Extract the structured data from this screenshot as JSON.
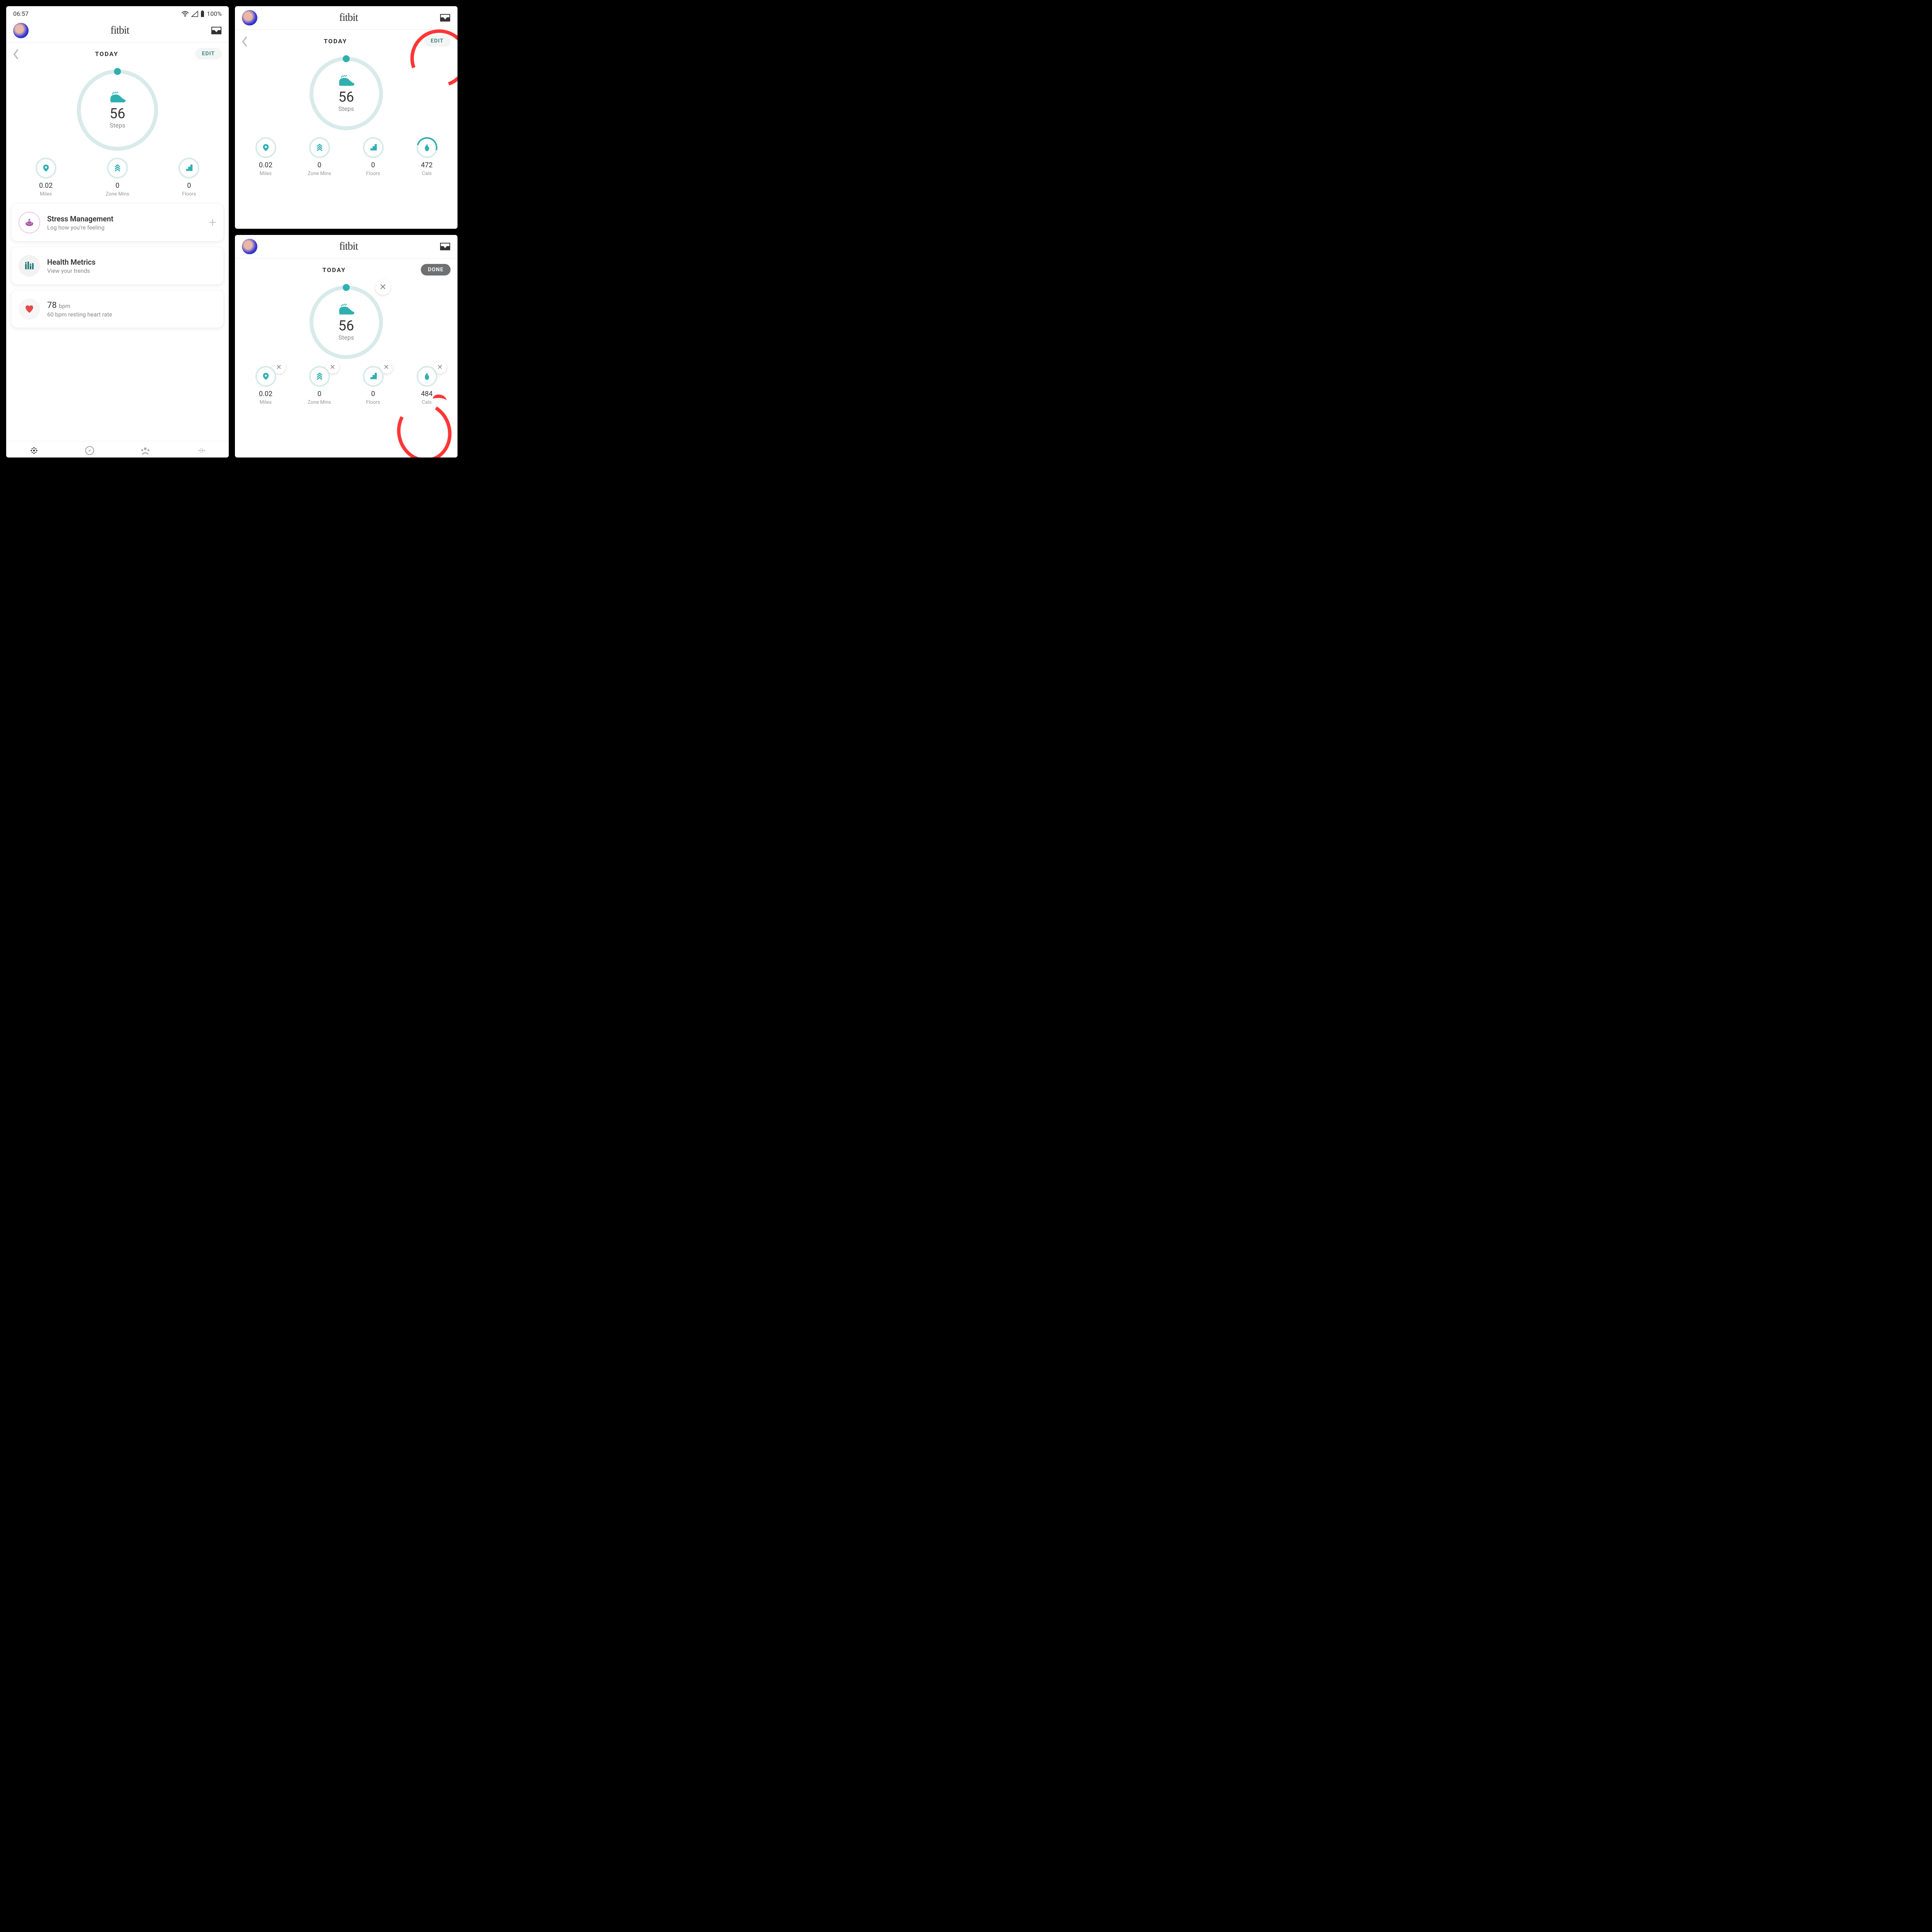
{
  "logo": "fitbit",
  "screens": {
    "a": {
      "today": "TODAY",
      "edit": "EDIT",
      "steps": {
        "count": "56",
        "unit": "Steps"
      },
      "stats": {
        "miles": {
          "val": "0.02",
          "lab": "Miles"
        },
        "zone": {
          "val": "0",
          "lab": "Zone Mins"
        },
        "floors": {
          "val": "0",
          "lab": "Floors"
        },
        "cals": {
          "val": "472",
          "lab": "Cals"
        }
      }
    },
    "b": {
      "today": "TODAY",
      "done": "DONE",
      "steps": {
        "count": "56",
        "unit": "Steps"
      },
      "stats": {
        "miles": {
          "val": "0.02",
          "lab": "Miles"
        },
        "zone": {
          "val": "0",
          "lab": "Zone Mins"
        },
        "floors": {
          "val": "0",
          "lab": "Floors"
        },
        "cals": {
          "val": "484",
          "lab": "Cals"
        }
      }
    },
    "c": {
      "status": {
        "time": "06:57",
        "battery": "100%"
      },
      "today": "TODAY",
      "edit": "EDIT",
      "steps": {
        "count": "56",
        "unit": "Steps"
      },
      "stats": {
        "miles": {
          "val": "0.02",
          "lab": "Miles"
        },
        "zone": {
          "val": "0",
          "lab": "Zone Mins"
        },
        "floors": {
          "val": "0",
          "lab": "Floors"
        }
      },
      "cards": {
        "stress": {
          "title": "Stress Management",
          "sub": "Log how you're feeling"
        },
        "metrics": {
          "title": "Health Metrics",
          "sub": "View your trends"
        },
        "heart": {
          "bpm": "78",
          "bpm_unit": "bpm",
          "sub": "60 bpm resting heart rate"
        }
      }
    }
  }
}
